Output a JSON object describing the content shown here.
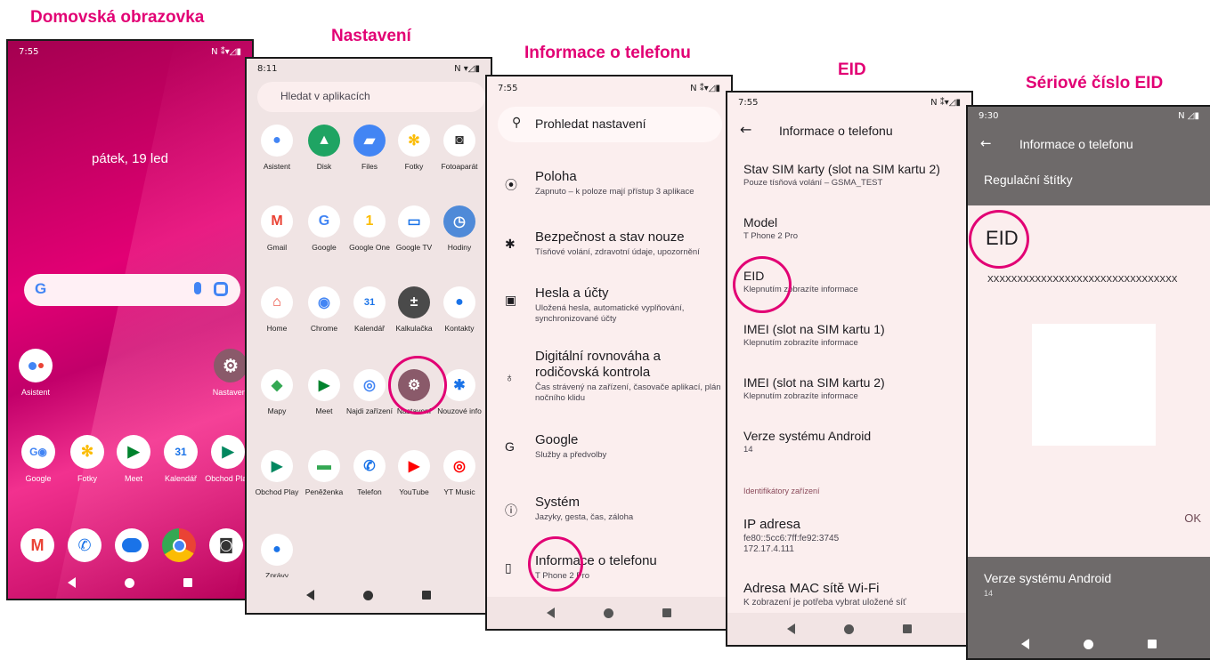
{
  "headings": {
    "home": "Domovská obrazovka",
    "settings": "Nastavení",
    "about": "Informace o telefonu",
    "eid": "EID",
    "eid_serial": "Sériové číslo EID"
  },
  "colors": {
    "brand": "#e20074",
    "screen_bg": "#fbeeee"
  },
  "home": {
    "time": "7:55",
    "status_icons": "N ⁑▾◿▮",
    "date": "pátek, 19 led",
    "search_logo": "G",
    "apps_row1": [
      "Asistent",
      "Nastavení"
    ],
    "dock_labels": [
      "Google",
      "Fotky",
      "Meet",
      "Kalendář",
      "Obchod Play"
    ],
    "bottom_icons": [
      "gmail-icon",
      "phone-icon",
      "messages-icon",
      "chrome-icon",
      "camera-icon"
    ]
  },
  "drawer": {
    "time": "8:11",
    "status_icons": "N ▾◿▮",
    "search_placeholder": "Hledat v aplikacích",
    "rows": [
      [
        "Asistent",
        "Disk",
        "Files",
        "Fotky",
        "Fotoaparát"
      ],
      [
        "Gmail",
        "Google",
        "Google One",
        "Google TV",
        "Hodiny"
      ],
      [
        "Home",
        "Chrome",
        "Kalendář",
        "Kalkulačka",
        "Kontakty"
      ],
      [
        "Mapy",
        "Meet",
        "Najdi zařízení",
        "Nastavení",
        "Nouzové info"
      ],
      [
        "Obchod Play",
        "Peněženka",
        "Telefon",
        "YouTube",
        "YT Music"
      ],
      [
        "Zprávy"
      ]
    ]
  },
  "settings": {
    "time": "7:55",
    "status_icons": "N ⁑▾◿▮",
    "search_placeholder": "Prohledat nastavení",
    "items": [
      {
        "title": "Poloha",
        "subtitle": "Zapnuto – k poloze mají přístup 3 aplikace",
        "icon": "location-icon"
      },
      {
        "title": "Bezpečnost a stav nouze",
        "subtitle": "Tísňové volání, zdravotní údaje, upozornění",
        "icon": "asterisk-icon"
      },
      {
        "title": "Hesla a účty",
        "subtitle": "Uložená hesla, automatické vyplňování, synchronizované účty",
        "icon": "account-box-icon"
      },
      {
        "title": "Digitální rovnováha a rodičovská kontrola",
        "subtitle": "Čas strávený na zařízení, časovače aplikací, plán nočního klidu",
        "icon": "wellbeing-icon"
      },
      {
        "title": "Google",
        "subtitle": "Služby a předvolby",
        "icon": "google-icon"
      },
      {
        "title": "Systém",
        "subtitle": "Jazyky, gesta, čas, záloha",
        "icon": "info-icon"
      },
      {
        "title": "Informace o telefonu",
        "subtitle": "T Phone 2 Pro",
        "icon": "phone-info-icon"
      }
    ]
  },
  "about": {
    "time": "7:55",
    "status_icons": "N ⁑▾◿▮",
    "title": "Informace o telefonu",
    "items": [
      {
        "title": "Stav SIM karty (slot na SIM kartu 2)",
        "subtitle": "Pouze tísňová volání – GSMA_TEST"
      },
      {
        "title": "Model",
        "subtitle": "T Phone 2 Pro"
      },
      {
        "title": "EID",
        "subtitle": "Klepnutím zobrazíte informace"
      },
      {
        "title": "IMEI (slot na SIM kartu 1)",
        "subtitle": "Klepnutím zobrazíte informace"
      },
      {
        "title": "IMEI (slot na SIM kartu 2)",
        "subtitle": "Klepnutím zobrazíte informace"
      },
      {
        "title": "Verze systému Android",
        "subtitle": "14"
      }
    ],
    "section_header": "Identifikátory zařízení",
    "ip_title": "IP adresa",
    "ip_value": "fe80::5cc6:7ff:fe92:3745\n172.17.4.111",
    "mac_title": "Adresa MAC sítě Wi-Fi",
    "mac_subtitle": "K zobrazení je potřeba vybrat uložené síť"
  },
  "eid_dialog": {
    "time": "9:30",
    "status_icons": "N ◿▮",
    "title": "Informace o telefonu",
    "behind_item": "Regulační štítky",
    "dialog_title": "EID",
    "eid_value": "XXXXXXXXXXXXXXXXXXXXXXXXXXXXXXXX",
    "ok": "OK",
    "bottom_title": "Verze systému Android",
    "bottom_value": "14"
  }
}
